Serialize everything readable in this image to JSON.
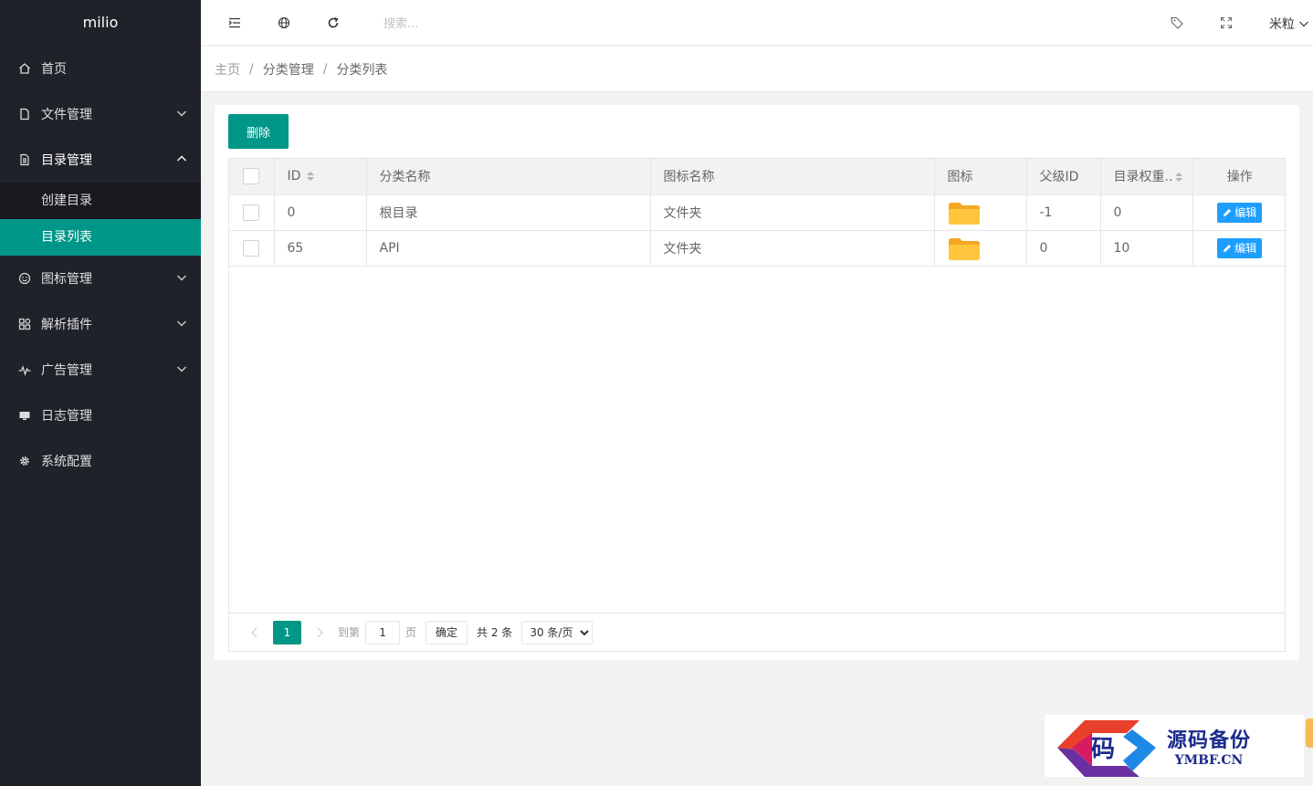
{
  "app": {
    "title": "milio"
  },
  "sidebar": {
    "items": [
      {
        "label": "首页",
        "icon": "home-icon"
      },
      {
        "label": "文件管理",
        "icon": "file-icon"
      },
      {
        "label": "目录管理",
        "icon": "doc-icon",
        "children": [
          {
            "label": "创建目录"
          },
          {
            "label": "目录列表",
            "active": true
          }
        ]
      },
      {
        "label": "图标管理",
        "icon": "smile-icon"
      },
      {
        "label": "解析插件",
        "icon": "apps-icon"
      },
      {
        "label": "广告管理",
        "icon": "pulse-icon"
      },
      {
        "label": "日志管理",
        "icon": "monitor-icon"
      },
      {
        "label": "系统配置",
        "icon": "gear-icon"
      }
    ]
  },
  "header": {
    "search_placeholder": "搜索...",
    "user": "米粒"
  },
  "breadcrumb": [
    "主页",
    "分类管理",
    "分类列表"
  ],
  "toolbar": {
    "delete_label": "删除"
  },
  "table": {
    "columns": [
      "ID",
      "分类名称",
      "图标名称",
      "图标",
      "父级ID",
      "目录权重..",
      "操作"
    ],
    "rows": [
      {
        "id": "0",
        "name": "根目录",
        "icon_name": "文件夹",
        "parent_id": "-1",
        "weight": "0",
        "action": "编辑"
      },
      {
        "id": "65",
        "name": "API",
        "icon_name": "文件夹",
        "parent_id": "0",
        "weight": "10",
        "action": "编辑"
      }
    ]
  },
  "pagination": {
    "current": "1",
    "goto_label": "到第",
    "page_value": "1",
    "page_label": "页",
    "confirm_label": "确定",
    "total_label": "共 2 条",
    "per_page": "30 条/页"
  },
  "watermark": {
    "cn": "源码备份",
    "en": "YMBF.CN",
    "glyph": "码"
  },
  "colors": {
    "sidebar_bg": "#20222a",
    "accent": "#009688",
    "edit_btn": "#1e9fff",
    "folder": "#ffc53d"
  }
}
